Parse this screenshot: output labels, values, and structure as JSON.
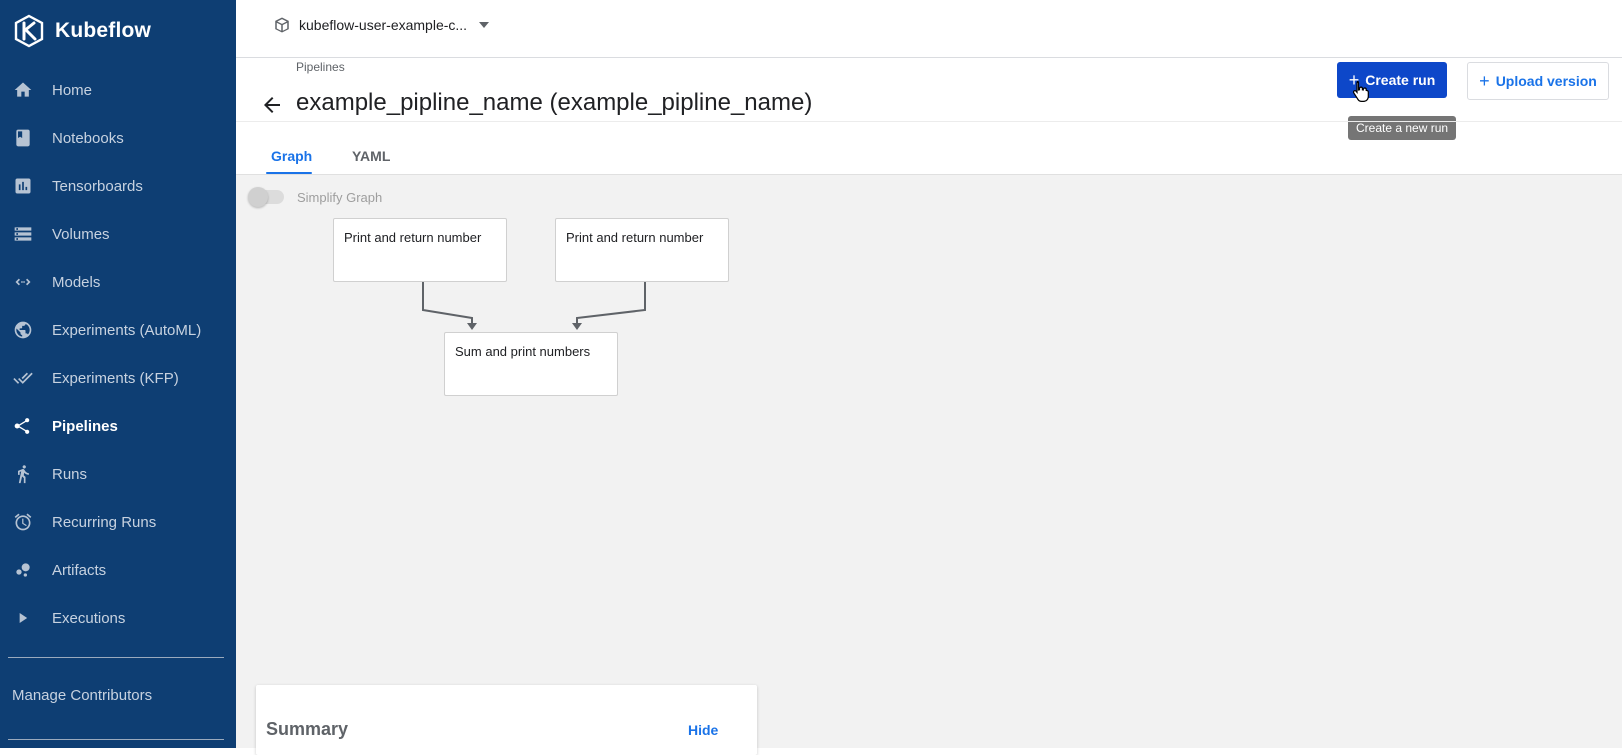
{
  "app": {
    "name": "Kubeflow"
  },
  "sidebar": {
    "items": [
      {
        "label": "Home",
        "icon": "home-icon"
      },
      {
        "label": "Notebooks",
        "icon": "notebook-icon"
      },
      {
        "label": "Tensorboards",
        "icon": "chart-icon"
      },
      {
        "label": "Volumes",
        "icon": "storage-icon"
      },
      {
        "label": "Models",
        "icon": "code-arrows-icon"
      },
      {
        "label": "Experiments (AutoML)",
        "icon": "automl-icon"
      },
      {
        "label": "Experiments (KFP)",
        "icon": "done-all-icon"
      },
      {
        "label": "Pipelines",
        "icon": "pipeline-icon",
        "active": true
      },
      {
        "label": "Runs",
        "icon": "run-icon"
      },
      {
        "label": "Recurring Runs",
        "icon": "alarm-icon"
      },
      {
        "label": "Artifacts",
        "icon": "bubble-icon"
      },
      {
        "label": "Executions",
        "icon": "play-icon"
      }
    ],
    "manage_label": "Manage Contributors"
  },
  "topbar": {
    "namespace": "kubeflow-user-example-c..."
  },
  "header": {
    "breadcrumb": "Pipelines",
    "title": "example_pipline_name (example_pipline_name)",
    "create_run_label": "Create run",
    "upload_version_label": "Upload version",
    "tooltip": "Create a new run"
  },
  "tabs": [
    {
      "label": "Graph",
      "active": true
    },
    {
      "label": "YAML",
      "active": false
    }
  ],
  "graph": {
    "simplify_label": "Simplify Graph",
    "simplify_on": false,
    "nodes": [
      {
        "label": "Print and return number"
      },
      {
        "label": "Print and return number"
      },
      {
        "label": "Sum and print numbers"
      }
    ]
  },
  "summary": {
    "title": "Summary",
    "hide_label": "Hide"
  },
  "colors": {
    "sidebar_bg": "#0e3e73",
    "primary": "#0d47c9",
    "accent": "#1a73e8",
    "canvas_bg": "#f2f2f2"
  }
}
